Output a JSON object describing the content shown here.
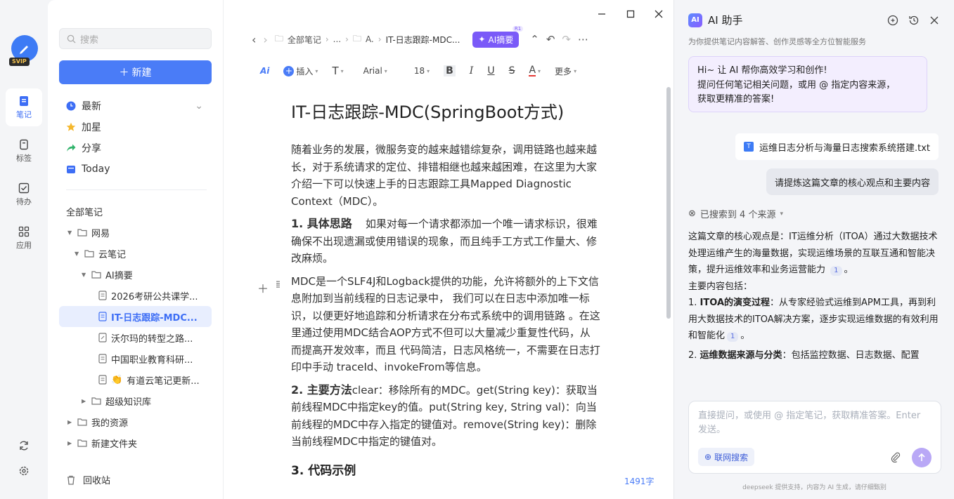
{
  "rail": {
    "vip_badge": "SVIP",
    "items": [
      {
        "label": "笔记",
        "icon": "note-icon"
      },
      {
        "label": "标签",
        "icon": "bookmark-icon"
      },
      {
        "label": "待办",
        "icon": "todo-icon"
      },
      {
        "label": "应用",
        "icon": "apps-icon"
      }
    ]
  },
  "sidebar": {
    "search_placeholder": "搜索",
    "new_label": "新建",
    "quick": [
      {
        "label": "最新"
      },
      {
        "label": "加星"
      },
      {
        "label": "分享"
      },
      {
        "label": "Today"
      }
    ],
    "tree_head": "全部笔记",
    "tree": [
      {
        "label": "网易"
      },
      {
        "label": "云笔记"
      },
      {
        "label": "AI摘要"
      },
      {
        "label": "2026考研公共课学..."
      },
      {
        "label": "IT-日志跟踪-MDC..."
      },
      {
        "label": "沃尔玛的转型之路..."
      },
      {
        "label": "中国职业教育科研..."
      },
      {
        "label": "有道云笔记更新..."
      },
      {
        "label": "超级知识库"
      },
      {
        "label": "我的资源"
      },
      {
        "label": "新建文件夹"
      }
    ],
    "trash": "回收站"
  },
  "editor": {
    "breadcrumb": [
      "全部笔记",
      "...",
      "A.",
      "IT-日志跟踪-MDC..."
    ],
    "ai_summary": "AI摘要",
    "ai_badge": "R1",
    "toolbar": {
      "insert": "插入",
      "font": "Arial",
      "size": "18",
      "more": "更多"
    },
    "title": "IT-日志跟踪-MDC(SpringBoot方式)",
    "p1": "随着业务的发展，微服务变的越来越错综复杂，调用链路也越来越长，对于系统请求的定位、排错相继也越来越困难，在这里为大家介绍一下可以快速上手的日志跟踪工具Mapped Diagnostic Context（MDC）。",
    "h_idea": "1. 具体思路",
    "p2": "如果对每一个请求都添加一个唯一请求标识，很难确保不出现遗漏或使用错误的现象，而且纯手工方式工作量大、修改麻烦。",
    "p3": "MDC是一个SLF4J和Logback提供的功能，允许将额外的上下文信息附加到当前线程的日志记录中， 我们可以在日志中添加唯一标识，以便更好地追踪和分析请求在分布式系统中的调用链路 。在这里通过使用MDC结合AOP方式不但可以大量减少重复性代码，从而提高开发效率，而且 代码简洁，日志风格统一，不需要在日志打印中手动 traceId、invokeFrom等信息。",
    "h_method": "2. 主要方法",
    "p4": "clear：移除所有的MDC。get(String key)：获取当前线程MDC中指定key的值。put(String key, String val)：向当前线程的MDC中存入指定的键值对。remove(String key)：删除当前线程MDC中指定的键值对。",
    "h_code": "3. 代码示例",
    "word_count": "1491字"
  },
  "ai_panel": {
    "title": "AI 助手",
    "subtitle": "为你提供笔记内容解答、创作灵感等全方位智能服务",
    "greet_1": "Hi~ 让 AI 帮你高效学习和创作!",
    "greet_2": "提问任何笔记相关问题，或用 @ 指定内容来源，",
    "greet_3": "获取更精准的答案!",
    "file": "运维日志分析与海量日志搜索系统搭建.txt",
    "question": "请提炼这篇文章的核心观点和主要内容",
    "sources": "已搜索到 4 个来源",
    "a1": "这篇文章的核心观点是：IT运维分析（ITOA）通过大数据技术处理运维产生的海量数据，实现运维场景的互联互通和智能决策，提升运维效率和业务运营能力",
    "cite": "1",
    "a_period": "。",
    "a2": "主要内容包括：",
    "a3_head": "ITOA的演变过程",
    "a3_prefix": "1. ",
    "a3": "：从专家经验式运维到APM工具，再到利用大数据技术的ITOA解决方案，逐步实现运维数据的有效利用和智能化",
    "a4_prefix": "2. ",
    "a4_head": "运维数据来源与分类",
    "a4": "：包括监控数据、日志数据、配置",
    "input_placeholder": "直接提问，或使用 @ 指定笔记，获取精准答案。Enter 发送。",
    "web_search": "联网搜索",
    "footer": "deepseek 提供支持，内容为 AI 生成，请仔细甄别"
  }
}
